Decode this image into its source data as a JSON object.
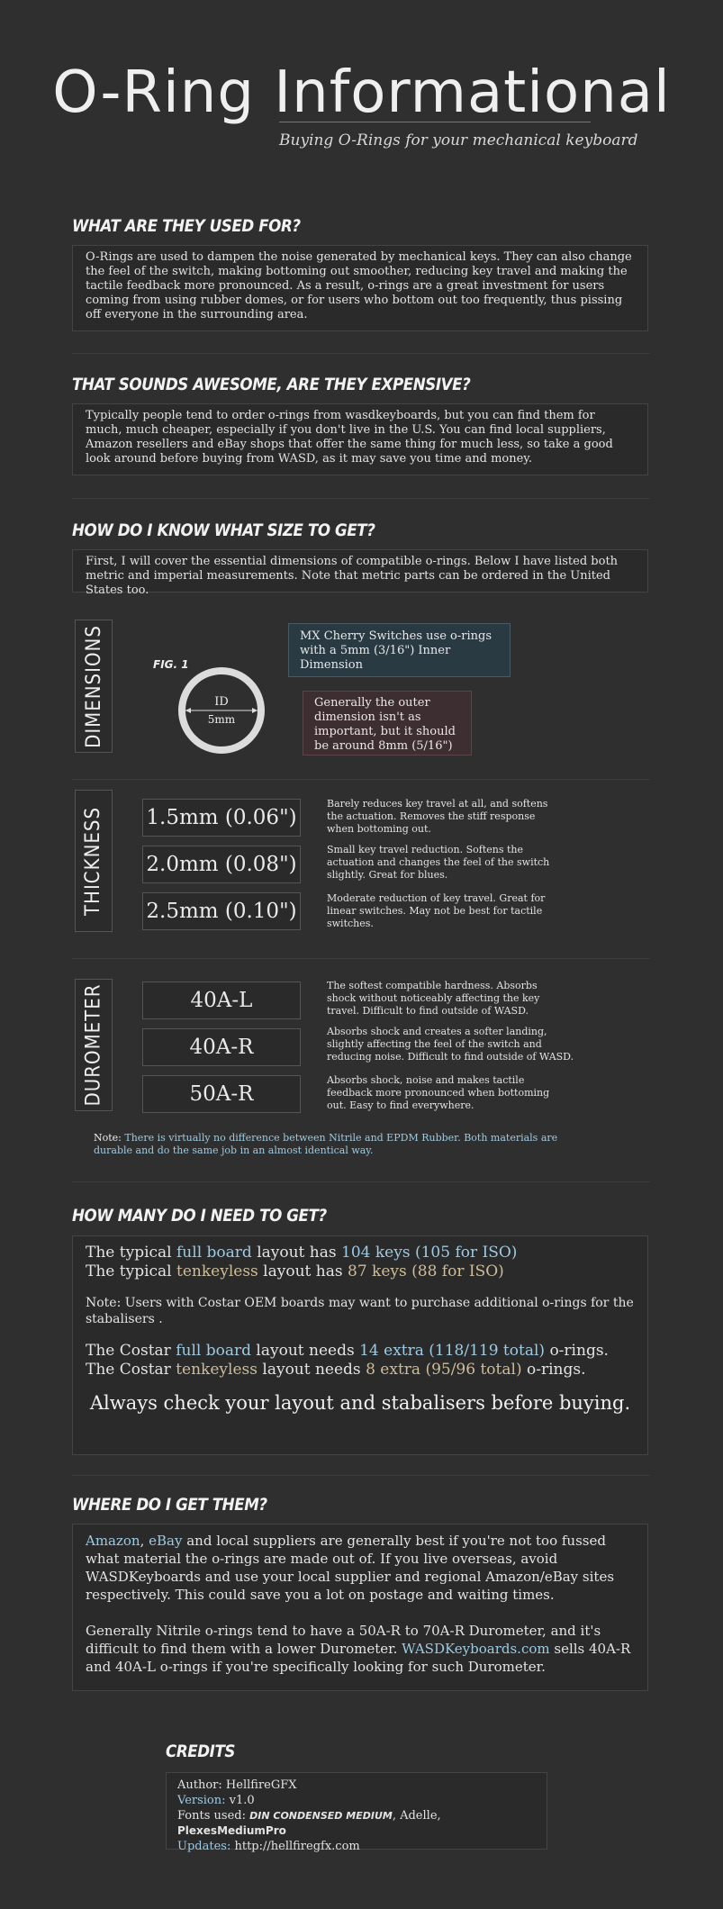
{
  "header": {
    "title": "O-Ring Informational",
    "subtitle": "Buying O-Rings for your mechanical keyboard"
  },
  "sections": {
    "used_for": {
      "heading": "WHAT ARE THEY USED FOR?",
      "body": "O-Rings are used to dampen the noise generated by mechanical keys. They can also change the feel of the switch, making bottoming out smoother, reducing key travel and making the tactile feedback more pronounced. As a result, o-rings are a great investment for users coming from using rubber domes, or for users who bottom out too frequently, thus pissing off everyone in the surrounding area."
    },
    "expensive": {
      "heading": "THAT SOUNDS AWESOME, ARE THEY EXPENSIVE?",
      "body": "Typically people tend to order o-rings from wasdkeyboards, but you can find them for much, much cheaper, especially if you don't live in the U.S. You can find local suppliers, Amazon resellers and eBay shops that offer the same thing for much less, so take a good look around before buying from WASD, as it may save you time and money."
    },
    "size": {
      "heading": "HOW DO I KNOW WHAT SIZE TO GET?",
      "body": "First, I will cover the essential dimensions of compatible o-rings. Below I have listed both metric and imperial measurements. Note that metric parts can be ordered in the United States too."
    }
  },
  "dimensions": {
    "label": "DIMENSIONS",
    "fig": "FIG. 1",
    "id_label": "ID",
    "id_value": "5mm",
    "callout_inner": "MX Cherry Switches use o-rings with a 5mm (3/16\") Inner Dimension",
    "callout_outer": "Generally the outer dimension isn't as important, but it should be around 8mm (5/16\")"
  },
  "thickness": {
    "label": "THICKNESS",
    "items": [
      {
        "value": "1.5mm (0.06\")",
        "desc": "Barely reduces key travel at all, and softens the actuation. Removes the stiff response when bottoming out."
      },
      {
        "value": "2.0mm (0.08\")",
        "desc": "Small key travel reduction. Softens the actuation and changes the feel of the switch slightly. Great for blues."
      },
      {
        "value": "2.5mm (0.10\")",
        "desc": "Moderate reduction of key travel. Great for linear switches. May not be best for tactile switches."
      }
    ]
  },
  "durometer": {
    "label": "DUROMETER",
    "items": [
      {
        "value": "40A-L",
        "desc": "The softest compatible hardness. Absorbs shock without noticeably affecting the key travel. Difficult to find outside of WASD."
      },
      {
        "value": "40A-R",
        "desc": "Absorbs shock and creates a softer landing, slightly affecting the feel of the switch and reducing noise. Difficult to find outside of WASD."
      },
      {
        "value": "50A-R",
        "desc": "Absorbs shock, noise and makes tactile feedback more pronounced when bottoming out. Easy to find everywhere."
      }
    ],
    "note_label": "Note:",
    "note": "There is virtually no difference between Nitrile and EPDM Rubber. Both materials are durable and do the same job in an almost identical way."
  },
  "how_many": {
    "heading": "HOW MANY DO I NEED TO GET?",
    "l1a": "The typical ",
    "l1b": "full board",
    "l1c": " layout has ",
    "l1d": "104 keys (105 for ISO)",
    "l2a": "The typical ",
    "l2b": "tenkeyless",
    "l2c": " layout has ",
    "l2d": "87 keys (88 for ISO)",
    "note": "Note: Users with Costar OEM boards may want to purchase additional o-rings for the stabalisers .",
    "l3a": "The Costar ",
    "l3b": "full board",
    "l3c": " layout needs ",
    "l3d": "14 extra (118/119 total)",
    "l3e": " o-rings.",
    "l4a": "The Costar ",
    "l4b": "tenkeyless",
    "l4c": " layout needs ",
    "l4d": "8 extra (95/96 total)",
    "l4e": " o-rings.",
    "callout": "Always check your layout and stabalisers before buying."
  },
  "where": {
    "heading": "WHERE DO I GET THEM?",
    "p1_amazon": "Amazon",
    "p1_sep": ", ",
    "p1_ebay": "eBay",
    "p1_rest": " and local suppliers are generally best if you're not too fussed what material the o-rings are made out of. If you live overseas, avoid WASDKeyboards and use your local supplier and regional Amazon/eBay sites respectively. This could save you a lot on postage and waiting times.",
    "p2_a": "Generally Nitrile o-rings tend to have a 50A-R to 70A-R Durometer, and it's difficult to find them with a lower Durometer. ",
    "p2_link": "WASDKeyboards.com",
    "p2_b": " sells 40A-R and 40A-L o-rings if you're specifically looking for such Durometer."
  },
  "credits": {
    "heading": "CREDITS",
    "author_label": "Author:",
    "author": "HellfireGFX",
    "version_label": "Version:",
    "version": "v1.0",
    "fonts_label": "Fonts used:",
    "font1": "DIN CONDENSED MEDIUM",
    "font2": "Adelle",
    "font3": "PlexesMediumPro",
    "updates_label": "Updates:",
    "updates": "http://hellfiregfx.com"
  },
  "colors": {
    "background": "#2f2f2f",
    "blue_accent": "#9ccbe3",
    "tan_accent": "#cdbd9a",
    "teal_box": "#2a3a42",
    "rose_box": "#3d2e32"
  }
}
